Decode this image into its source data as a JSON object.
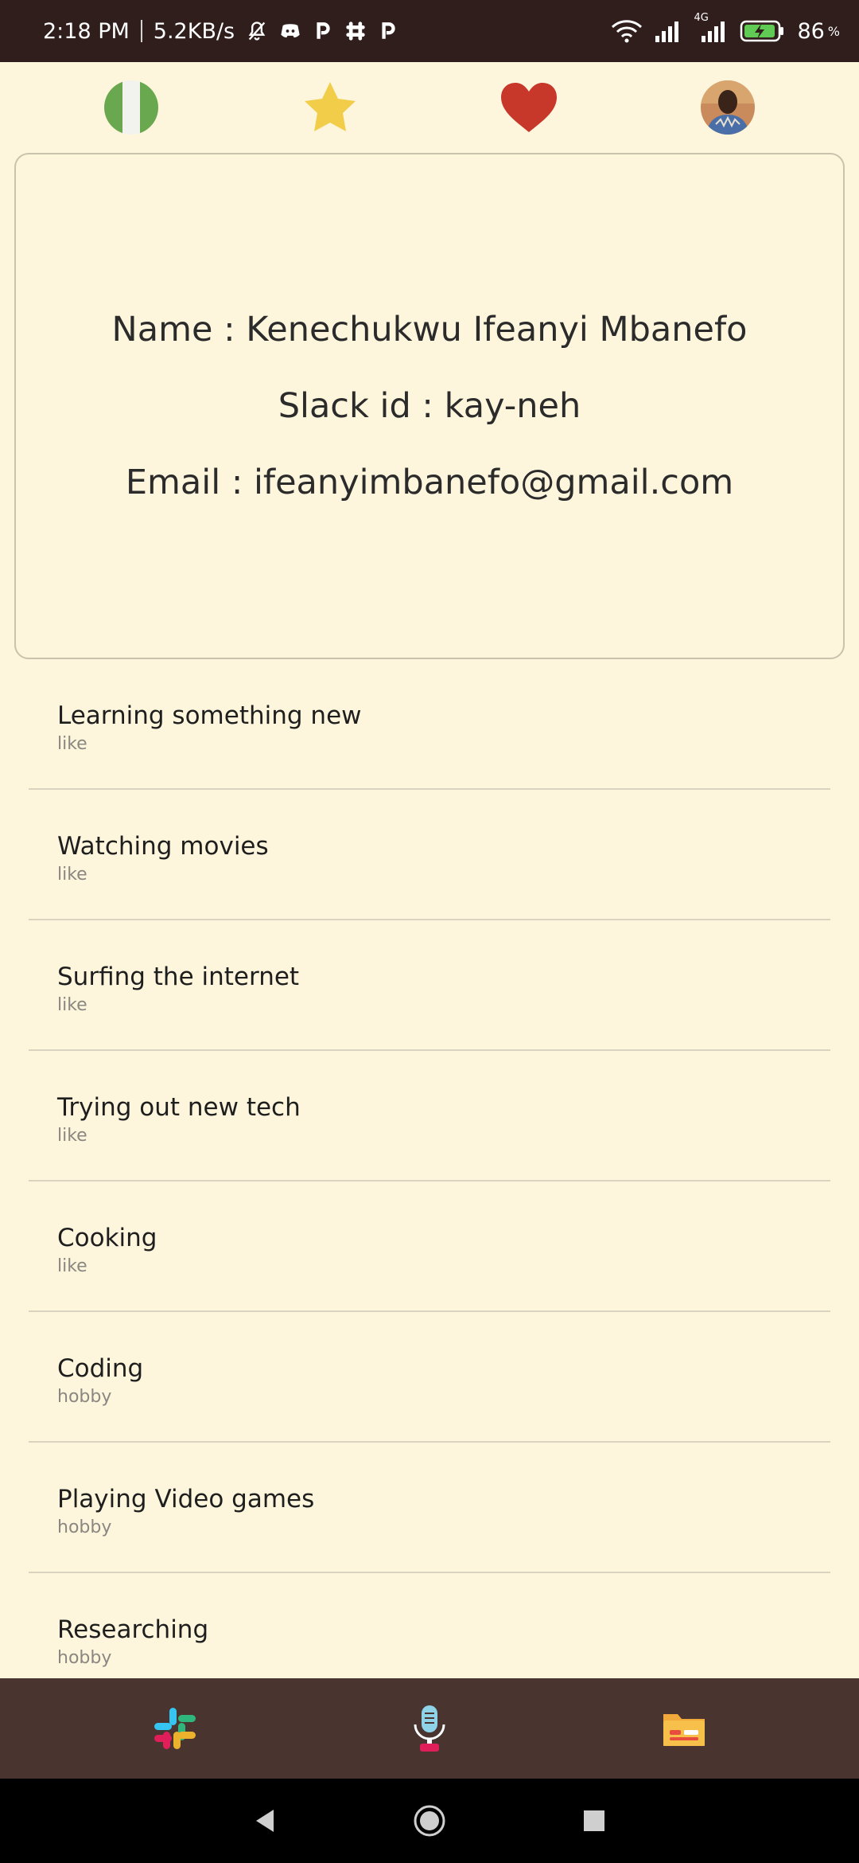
{
  "status_bar": {
    "time": "2:18 PM",
    "speed": "5.2KB/s",
    "battery": "86",
    "battery_unit": "%",
    "network_type": "4G",
    "icons": [
      "mute-icon",
      "discord-icon",
      "p-app-icon",
      "slack-icon",
      "p-app-icon",
      "wifi-icon",
      "signal-icon",
      "signal-4g-icon",
      "battery-charging-icon"
    ]
  },
  "top_icons": [
    "nigeria-flag-icon",
    "star-icon",
    "heart-icon",
    "avatar"
  ],
  "colors": {
    "background": "#fdf6dc",
    "status_bar": "#2f1e1c",
    "bottom_nav": "#4a3430",
    "star": "#f2cd4a",
    "heart": "#c7372a",
    "flag_green": "#6aa84f"
  },
  "profile": {
    "name_line": "Name : Kenechukwu Ifeanyi Mbanefo",
    "slack_line": "Slack id : kay-neh",
    "email_line": "Email : ifeanyimbanefo@gmail.com"
  },
  "items": [
    {
      "title": "Learning something new",
      "type": "like"
    },
    {
      "title": "Watching movies",
      "type": "like"
    },
    {
      "title": "Surfing the internet",
      "type": "like"
    },
    {
      "title": "Trying out new tech",
      "type": "like"
    },
    {
      "title": "Cooking",
      "type": "like"
    },
    {
      "title": "Coding",
      "type": "hobby"
    },
    {
      "title": "Playing Video games",
      "type": "hobby"
    },
    {
      "title": "Researching",
      "type": "hobby"
    }
  ],
  "bottom_nav": [
    "slack-icon",
    "microphone-icon",
    "folder-icon"
  ],
  "system_nav": [
    "back-icon",
    "home-icon",
    "recents-icon"
  ]
}
